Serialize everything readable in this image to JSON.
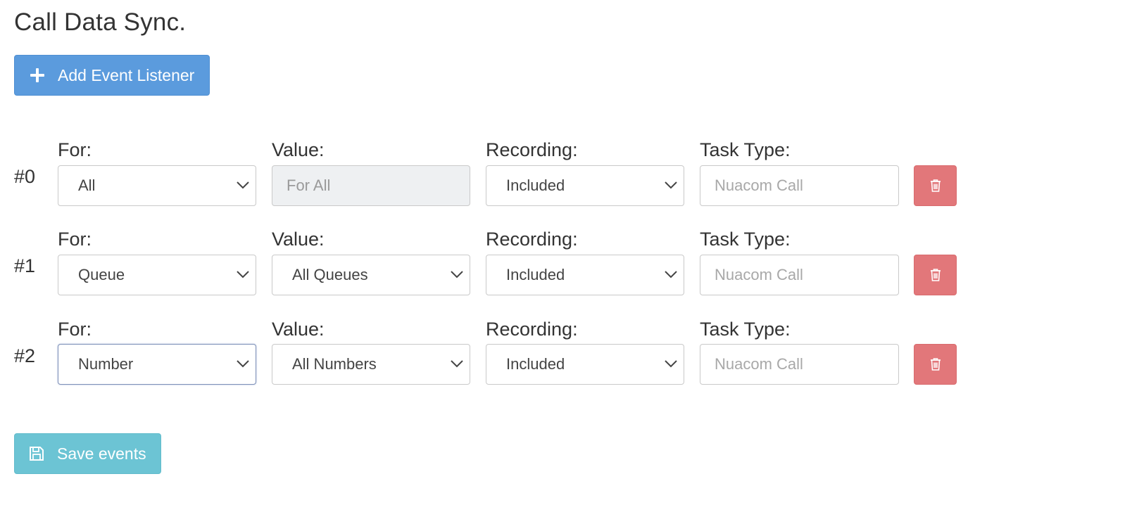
{
  "page": {
    "title": "Call Data Sync."
  },
  "toolbar": {
    "add_label": "Add Event Listener",
    "add_icon": "plus-icon"
  },
  "labels": {
    "for": "For:",
    "value": "Value:",
    "recording": "Recording:",
    "task_type": "Task Type:"
  },
  "rows": [
    {
      "index": "#0",
      "for": "All",
      "value": "For All",
      "value_disabled": true,
      "recording": "Included",
      "task_type_value": "",
      "task_type_placeholder": "Nuacom Call"
    },
    {
      "index": "#1",
      "for": "Queue",
      "value": "All Queues",
      "value_disabled": false,
      "recording": "Included",
      "task_type_value": "",
      "task_type_placeholder": "Nuacom Call"
    },
    {
      "index": "#2",
      "for": "Number",
      "value": "All Numbers",
      "value_disabled": false,
      "recording": "Included",
      "task_type_value": "",
      "task_type_placeholder": "Nuacom Call"
    }
  ],
  "footer": {
    "save_label": "Save events",
    "save_icon": "floppy-disk-icon"
  },
  "colors": {
    "add_button": "#5b9bdd",
    "save_button": "#6cc4d4",
    "delete_button": "#e2777a",
    "disabled_field": "#eef0f2"
  }
}
